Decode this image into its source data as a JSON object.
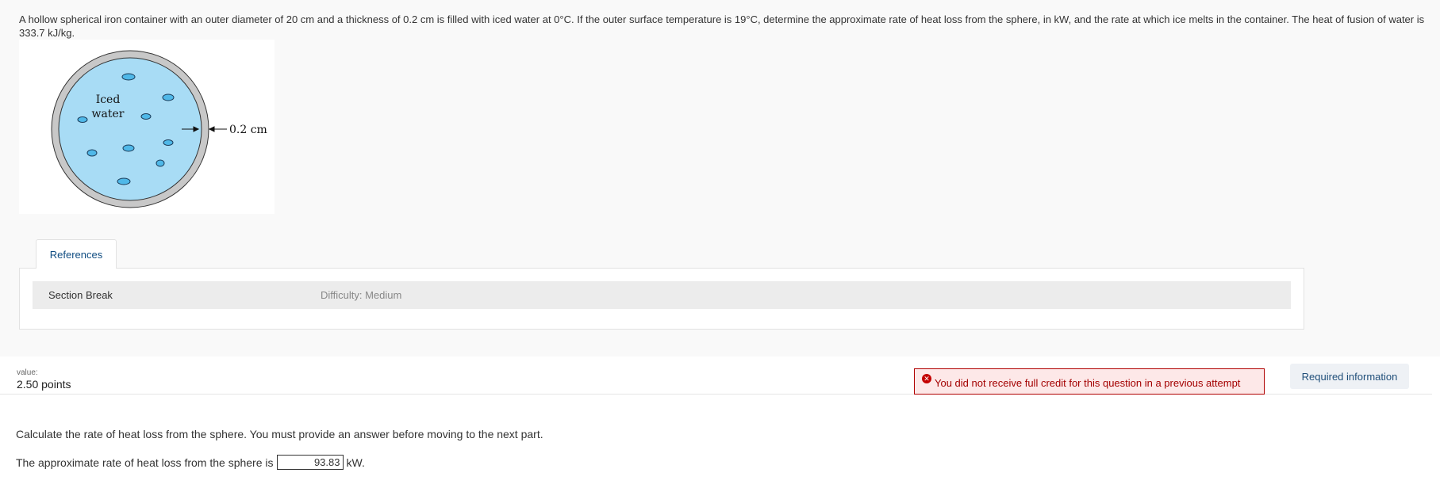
{
  "problem": {
    "text": "A hollow spherical iron container with an outer diameter of 20 cm and a thickness of 0.2 cm is filled with iced water at 0°C. If the outer surface temperature is 19°C, determine the approximate rate of heat loss from the sphere, in kW, and the rate at which ice melts in the container. The heat of fusion of water is 333.7 kJ/kg."
  },
  "figure": {
    "label_line1": "Iced",
    "label_line2": "water",
    "thickness_label": "0.2 cm",
    "colors": {
      "water": "#a8dcf5",
      "shell": "#c8c8c8",
      "ice": "#4fb8e8"
    }
  },
  "references": {
    "tab_label": "References",
    "section_label": "Section Break",
    "difficulty": "Difficulty: Medium"
  },
  "question": {
    "value_label": "value:",
    "points": "2.50 points",
    "error_message": "You did not receive full credit for this question in a previous attempt",
    "required_info_button": "Required information",
    "instruction": "Calculate the rate of heat loss from the sphere. You must provide an answer before moving to the next part.",
    "answer_prefix": "The approximate rate of heat loss from the sphere is",
    "answer_value": "93.83",
    "answer_unit": "kW."
  }
}
